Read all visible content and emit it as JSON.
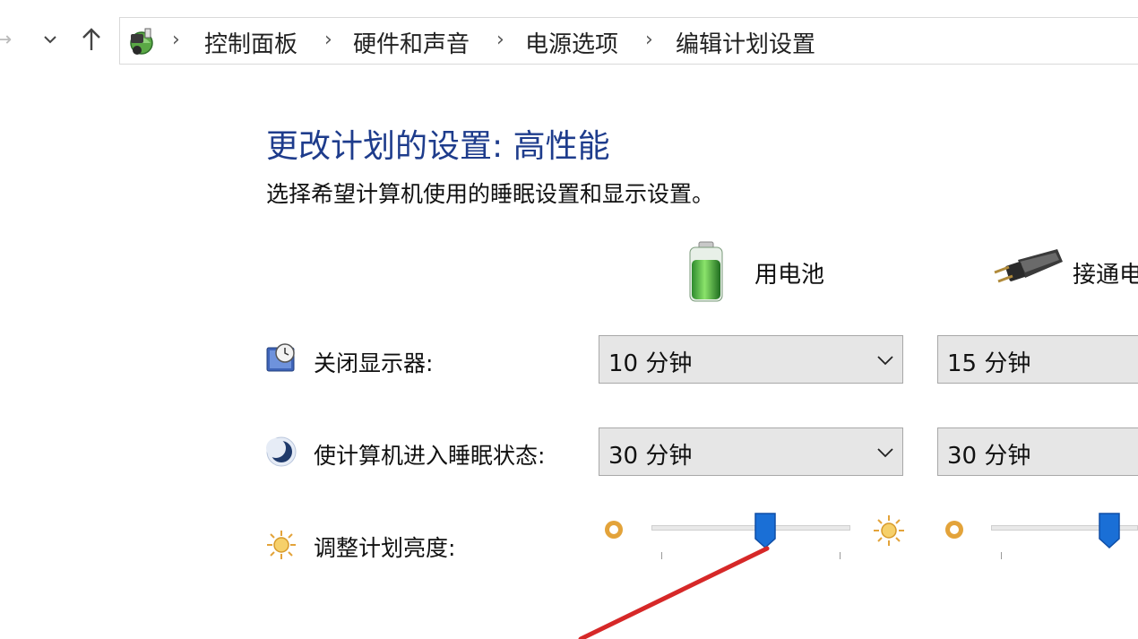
{
  "nav": {
    "forward_glyph": "→",
    "dropdown_glyph": "⌄",
    "up_glyph": "↑"
  },
  "breadcrumb": {
    "items": [
      "控制面板",
      "硬件和声音",
      "电源选项",
      "编辑计划设置"
    ],
    "separator": "›"
  },
  "page": {
    "title": "更改计划的设置: 高性能",
    "subtitle": "选择希望计算机使用的睡眠设置和显示设置。"
  },
  "columns": {
    "battery_label": "用电池",
    "plugged_label": "接通电"
  },
  "rows": {
    "display_off": {
      "label": "关闭显示器:",
      "battery_value": "10 分钟",
      "plugged_value": "15 分钟"
    },
    "sleep": {
      "label": "使计算机进入睡眠状态:",
      "battery_value": "30 分钟",
      "plugged_value": "30 分钟"
    },
    "brightness": {
      "label": "调整计划亮度:",
      "battery_level": 0.57,
      "plugged_level": 0.6
    }
  },
  "colors": {
    "title": "#1e3c8c",
    "thumb": "#1a6fd6",
    "annotation_arrow": "#d62828"
  }
}
